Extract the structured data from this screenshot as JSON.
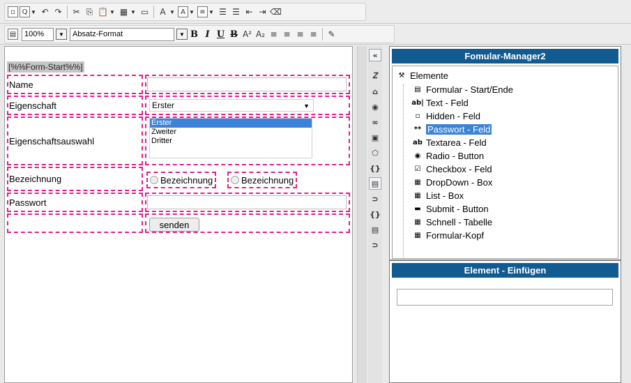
{
  "toolbar1": {
    "icons": [
      "new-doc-icon",
      "preview-icon",
      "undo-icon",
      "redo-icon",
      "cut-icon",
      "copy-icon",
      "paste-icon",
      "table-icon",
      "box-icon",
      "text-color-icon",
      "bg-color-icon",
      "list-icon",
      "ordered-list-icon",
      "unordered-list-icon",
      "outdent-icon",
      "indent-icon",
      "eraser-icon"
    ]
  },
  "toolbar2": {
    "zoom": "100%",
    "paragraph_format": "Absatz-Format",
    "bold": "B",
    "italic": "I",
    "underline": "U",
    "strike": "B"
  },
  "editor": {
    "form_start": "[%%Form-Start%%]",
    "rows": [
      {
        "label": "Name"
      },
      {
        "label": "Eigenschaft",
        "select_value": "Erster"
      },
      {
        "label": "Eigenschaftsauswahl",
        "options": [
          "Erster",
          "Zweiter",
          "Dritter"
        ],
        "selected": 0
      },
      {
        "label": "Bezeichnung",
        "radio1": "Bezeichnung",
        "radio2": "Bezeichnung"
      },
      {
        "label": "Passwort"
      }
    ],
    "submit_label": "senden"
  },
  "manager": {
    "title": "Fomular-Manager2",
    "root": "Elemente",
    "items": [
      {
        "label": "Formular - Start/Ende",
        "icon": "form-icon"
      },
      {
        "label": "Text - Feld",
        "icon": "text-field-icon"
      },
      {
        "label": "Hidden - Feld",
        "icon": "hidden-field-icon"
      },
      {
        "label": "Passwort - Feld",
        "icon": "password-field-icon",
        "selected": true
      },
      {
        "label": "Textarea - Feld",
        "icon": "textarea-icon"
      },
      {
        "label": "Radio - Button",
        "icon": "radio-icon"
      },
      {
        "label": "Checkbox - Feld",
        "icon": "checkbox-icon"
      },
      {
        "label": "DropDown - Box",
        "icon": "dropdown-icon"
      },
      {
        "label": "List - Box",
        "icon": "listbox-icon"
      },
      {
        "label": "Submit - Button",
        "icon": "submit-icon"
      },
      {
        "label": "Schnell - Tabelle",
        "icon": "table-icon"
      },
      {
        "label": "Formular-Kopf",
        "icon": "form-header-icon"
      }
    ]
  },
  "insert": {
    "title": "Element - Einfügen"
  }
}
